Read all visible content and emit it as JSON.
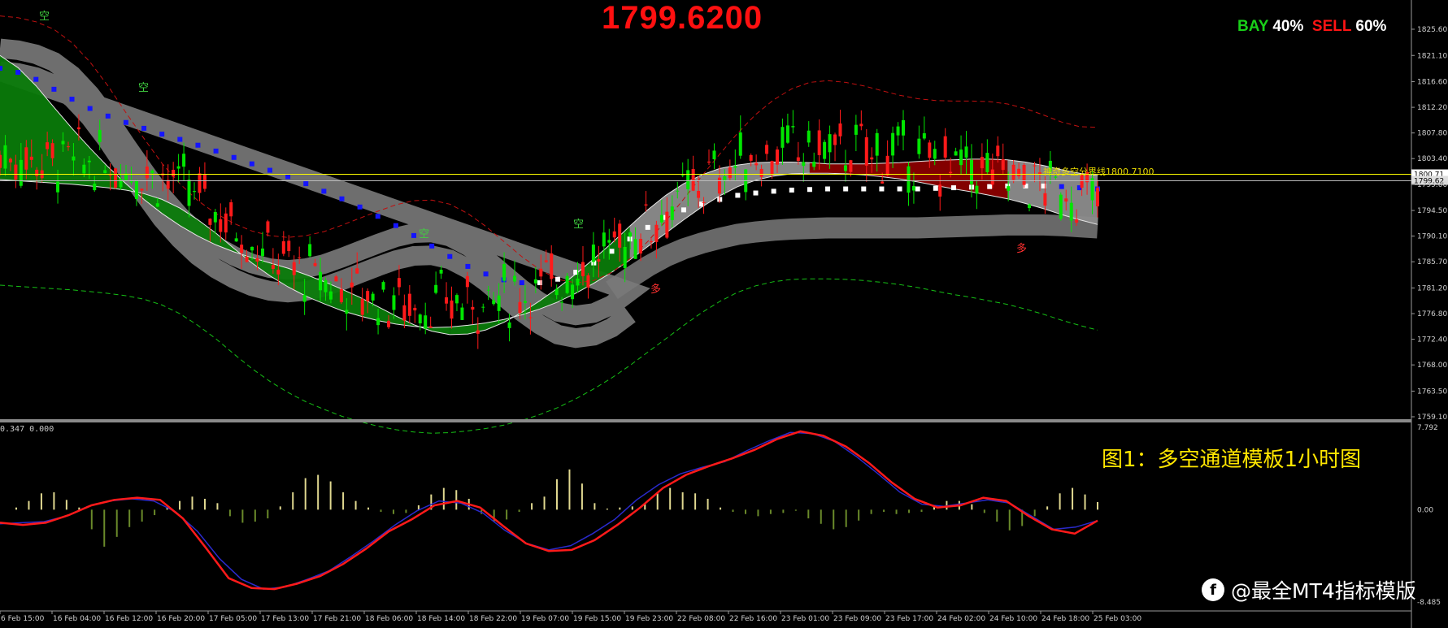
{
  "header": {
    "price_readout": "1799.6200",
    "bay_label": "BAY",
    "bay_pct": "40%",
    "sell_label": "SELL",
    "sell_pct": "60%"
  },
  "indicator": {
    "label": "0.347 0.000"
  },
  "channel_line_label": "神奇多空分界线1800.7100",
  "caption": "图1：多空通道模板1小时图",
  "watermark": "@最全MT4指标模版",
  "colors": {
    "bull_zone": "#0a7a0a",
    "bear_zone": "#8a0000",
    "neutral_zone": "#8c8c8c",
    "up_candle": "#00e600",
    "down_candle": "#ff1a1a",
    "trend_down": "#1414ff",
    "trend_up": "#ffffff",
    "signal_line": "#ff1a1a",
    "macd_line": "#2a2acc",
    "histogram": "#e0d890",
    "level_line": "#ffff00"
  },
  "chart_data": [
    {
      "type": "line",
      "panel": "price",
      "ylim": [
        1759.1,
        1829.5
      ],
      "y_ticks": [
        "1825.60",
        "1821.10",
        "1816.60",
        "1812.20",
        "1807.80",
        "1803.40",
        "1799.00",
        "1794.50",
        "1790.10",
        "1785.70",
        "1781.20",
        "1776.80",
        "1772.40",
        "1768.00",
        "1763.50",
        "1759.10"
      ],
      "current_price_tags": [
        "1800.71",
        "1799.62"
      ],
      "horizontal_line": 1800.71,
      "x_ticks": [
        "6 Feb 15:00",
        "16 Feb 04:00",
        "16 Feb 12:00",
        "16 Feb 20:00",
        "17 Feb 05:00",
        "17 Feb 13:00",
        "17 Feb 21:00",
        "18 Feb 06:00",
        "18 Feb 14:00",
        "18 Feb 22:00",
        "19 Feb 07:00",
        "19 Feb 15:00",
        "19 Feb 23:00",
        "22 Feb 08:00",
        "22 Feb 16:00",
        "23 Feb 01:00",
        "23 Feb 09:00",
        "23 Feb 17:00",
        "24 Feb 02:00",
        "24 Feb 10:00",
        "24 Feb 18:00",
        "25 Feb 03:00"
      ],
      "signal_labels": [
        "空",
        "空",
        "空",
        "多",
        "空",
        "多"
      ],
      "series": [
        {
          "values": [
            1822.3,
            1822.0,
            1821.3,
            1820.0,
            1817.7,
            1814.4,
            1810.3,
            1805.7,
            1801.3,
            1797.0,
            1793.5,
            1790.6,
            1788.4,
            1786.7,
            1785.4,
            1784.6,
            1784.3,
            1784.6,
            1785.3,
            1786.4,
            1787.6,
            1788.8,
            1789.9,
            1790.6,
            1790.7,
            1790.0,
            1788.4,
            1786.2,
            1783.6,
            1781.0,
            1778.8,
            1777.1,
            1776.5,
            1776.9,
            1778.3,
            1780.6,
            1783.6,
            1787.1,
            1790.9,
            1794.8,
            1798.6,
            1802.2,
            1805.4,
            1807.9,
            1809.8,
            1810.9,
            1811.2,
            1810.9,
            1810.3,
            1809.5,
            1808.7,
            1808.1,
            1807.8,
            1807.7,
            1807.7,
            1807.6,
            1807.2,
            1806.4,
            1805.3,
            1804.1,
            1803.3,
            1803.2
          ]
        },
        {
          "values": [
            1821.1,
            1819.0,
            1815.9,
            1812.2,
            1808.6,
            1805.2,
            1802.0,
            1799.1,
            1796.4,
            1794.0,
            1791.9,
            1790.1,
            1788.6,
            1787.4,
            1786.4,
            1785.5,
            1784.6,
            1783.5,
            1782.3,
            1781.0,
            1779.6,
            1778.0,
            1776.4,
            1774.9,
            1773.8,
            1773.2,
            1773.3,
            1774.0,
            1775.3,
            1777.0,
            1779.0,
            1781.2,
            1783.6,
            1786.2,
            1788.9,
            1791.8,
            1794.6,
            1797.1,
            1799.1,
            1800.6,
            1801.7,
            1802.3,
            1802.7,
            1802.8,
            1802.8,
            1802.7,
            1802.5,
            1802.5,
            1802.5,
            1802.6,
            1802.7,
            1802.9,
            1803.1,
            1803.2,
            1803.3,
            1803.3,
            1803.2,
            1802.8,
            1802.2,
            1801.5,
            1800.9,
            1800.5
          ]
        },
        {
          "values": [
            1818.9,
            1818.2,
            1817.0,
            1815.3,
            1813.6,
            1812.0,
            1810.7,
            1809.6,
            1808.6,
            1807.6,
            1806.7,
            1805.7,
            1804.7,
            1803.6,
            1802.5,
            1801.4,
            1800.3,
            1799.1,
            1797.8,
            1796.5,
            1795.1,
            1793.5,
            1791.9,
            1790.2,
            1788.4,
            1786.6,
            1784.9,
            1783.6,
            1782.6,
            1782.1,
            1782.1,
            1782.7,
            1783.9,
            1785.5,
            1787.5,
            1789.6,
            1791.6,
            1793.3,
            1794.6,
            1795.6,
            1796.4,
            1797.1,
            1797.5,
            1797.8,
            1798.0,
            1798.1,
            1798.2,
            1798.2,
            1798.2,
            1798.2,
            1798.2,
            1798.2,
            1798.3,
            1798.4,
            1798.5,
            1798.6,
            1798.7,
            1798.7,
            1798.7,
            1798.6,
            1798.4,
            1798.2
          ]
        },
        {
          "values": [
            1799.8,
            1799.6,
            1799.4,
            1799.2,
            1799.0,
            1798.7,
            1798.4,
            1798.0,
            1797.4,
            1796.4,
            1794.9,
            1792.9,
            1790.6,
            1788.0,
            1785.5,
            1783.3,
            1781.4,
            1779.8,
            1778.5,
            1777.3,
            1776.4,
            1775.6,
            1775.0,
            1774.6,
            1774.4,
            1774.5,
            1774.8,
            1775.2,
            1775.8,
            1776.6,
            1777.6,
            1778.8,
            1780.3,
            1782.0,
            1783.9,
            1786.0,
            1788.3,
            1790.6,
            1792.9,
            1795.1,
            1797.0,
            1798.6,
            1799.7,
            1800.4,
            1800.8,
            1800.9,
            1800.9,
            1800.8,
            1800.6,
            1800.3,
            1799.9,
            1799.4,
            1798.8,
            1798.2,
            1797.7,
            1797.1,
            1796.5,
            1795.7,
            1794.8,
            1793.8,
            1792.9,
            1792.1
          ]
        }
      ]
    },
    {
      "type": "bar",
      "panel": "indicator",
      "ylim": [
        -8.485,
        7.792
      ],
      "y_ticks": [
        "7.792",
        "0.00",
        "-8.485"
      ],
      "series": [
        {
          "values": [
            0.2,
            0.8,
            1.5,
            1.6,
            0.9,
            0.2,
            -1.8,
            -3.4,
            -2.5,
            -1.6,
            -1.1,
            -0.5,
            0.2,
            0.8,
            1.2,
            1.0,
            0.6,
            -0.6,
            -1.2,
            -1.1,
            -0.8,
            0.3,
            1.6,
            2.9,
            3.2,
            2.6,
            1.6,
            0.8,
            0.2,
            -0.2,
            -0.4,
            -0.3,
            0.4,
            1.4,
            2.0,
            1.8,
            1.0,
            -0.4,
            -1.1,
            -0.9,
            -0.2,
            0.6,
            1.2,
            2.8,
            3.7,
            2.4,
            0.6,
            0.1,
            0.2,
            0.3,
            0.5,
            1.5,
            2.0,
            1.6,
            1.5,
            1.0,
            0.2,
            -0.2,
            -0.4,
            -0.6,
            -0.4,
            -0.3,
            -0.1,
            -0.8,
            -1.3,
            -1.8,
            -1.6,
            -1.0,
            -0.4,
            -0.2,
            -0.4,
            -0.3,
            -0.2,
            0.3,
            0.8,
            0.8,
            0.5,
            -0.3,
            -1.1,
            -1.9,
            -1.5,
            -0.6,
            0.3,
            1.5,
            2.0,
            1.4,
            0.7
          ]
        },
        {
          "values": [
            -1.2,
            -1.4,
            -1.2,
            -0.5,
            0.4,
            0.9,
            1.1,
            0.9,
            -0.8,
            -3.5,
            -6.3,
            -7.2,
            -7.3,
            -6.8,
            -6.1,
            -5.0,
            -3.6,
            -2.0,
            -0.9,
            0.4,
            0.8,
            0.2,
            -1.5,
            -3.1,
            -3.8,
            -3.7,
            -2.8,
            -1.4,
            0.2,
            2.0,
            3.2,
            4.0,
            4.7,
            5.5,
            6.5,
            7.2,
            6.8,
            5.8,
            4.3,
            2.5,
            1.0,
            0.2,
            0.4,
            1.1,
            0.8,
            -0.6,
            -1.8,
            -2.2,
            -1.0
          ]
        },
        {
          "values": [
            -1.3,
            -1.2,
            -1.1,
            -0.6,
            0.3,
            0.8,
            1.0,
            0.8,
            -0.2,
            -2.0,
            -4.5,
            -6.4,
            -7.3,
            -7.1,
            -6.4,
            -5.6,
            -4.3,
            -2.9,
            -1.4,
            -0.1,
            0.8,
            0.6,
            -0.3,
            -1.9,
            -3.1,
            -3.7,
            -3.3,
            -2.2,
            -0.9,
            0.9,
            2.3,
            3.3,
            3.9,
            4.4,
            5.4,
            6.3,
            7.1,
            7.0,
            6.3,
            4.9,
            3.3,
            1.6,
            0.5,
            0.3,
            0.6,
            0.9,
            0.6,
            -0.6,
            -1.8,
            -1.6,
            -1.0
          ]
        }
      ]
    }
  ]
}
